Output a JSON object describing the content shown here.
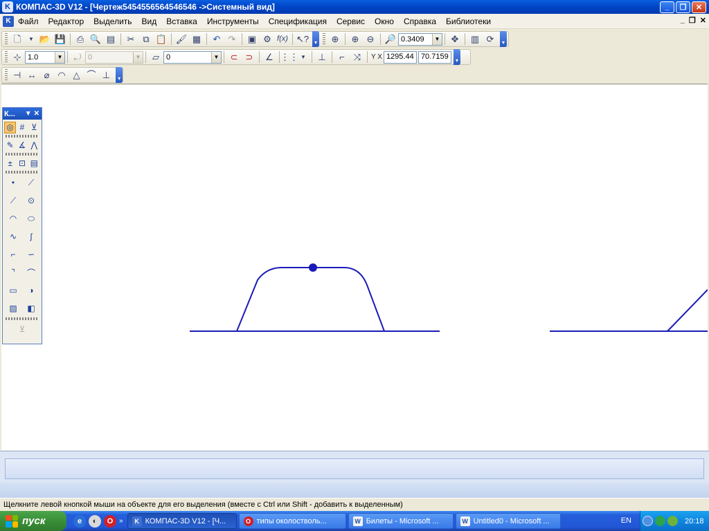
{
  "window": {
    "title": "КОМПАС-3D V12 - [Чертеж5454556564546546 ->Системный вид]",
    "app_icon": "kompas-icon"
  },
  "menu": {
    "items": [
      "Файл",
      "Редактор",
      "Выделить",
      "Вид",
      "Вставка",
      "Инструменты",
      "Спецификация",
      "Сервис",
      "Окно",
      "Справка",
      "Библиотеки"
    ]
  },
  "toolbar": {
    "zoom_value": "0.3409",
    "step_value": "1.0",
    "angle_value": "0",
    "layer_value": "0",
    "coord_label": "Y X",
    "coord_x": "1295.44",
    "coord_y": "70.7159"
  },
  "compact_panel": {
    "title": "К..."
  },
  "status": {
    "text": "Щелкните левой кнопкой мыши на объекте для его выделения (вместе с Ctrl или Shift - добавить к выделенным)"
  },
  "taskbar": {
    "start_label": "пуск",
    "tasks": [
      {
        "label": "КОМПАС-3D V12 - [Ч...",
        "icon": "kompas-icon",
        "active": true
      },
      {
        "label": "типы околостволь...",
        "icon": "opera-icon",
        "active": false
      },
      {
        "label": "Билеты - Microsoft ...",
        "icon": "word-icon",
        "active": false
      },
      {
        "label": "Untitled0 - Microsoft ...",
        "icon": "word-icon",
        "active": false
      }
    ],
    "language": "EN",
    "clock": "20:18"
  },
  "colors": {
    "geometry": "#1a1ab8",
    "selection_point": "#1a1ab8"
  }
}
